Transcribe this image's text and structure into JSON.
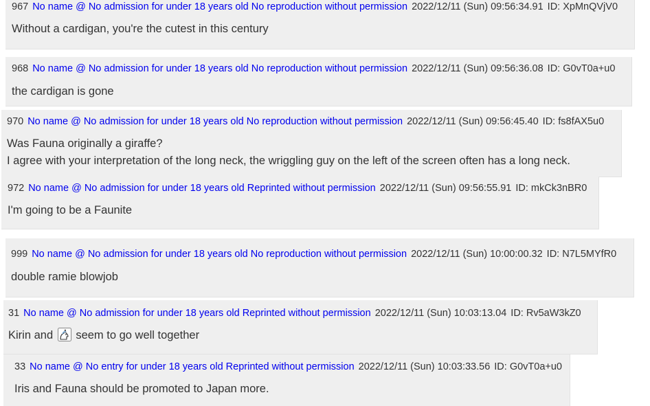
{
  "posts": [
    {
      "number": "967",
      "name": "No name @ No admission for under 18 years old No reproduction without permission",
      "date": "2022/12/11 (Sun) 09:56:34.91",
      "id": "ID: XpMnQVjV0",
      "lines": [
        "Without a cardigan, you're the cutest in this century"
      ]
    },
    {
      "number": "968",
      "name": "No name @ No admission for under 18 years old No reproduction without permission",
      "date": "2022/12/11 (Sun) 09:56:36.08",
      "id": "ID: G0vT0a+u0",
      "lines": [
        "the cardigan is gone"
      ]
    },
    {
      "number": "970",
      "name": "No name @ No admission for under 18 years old No reproduction without permission",
      "date": "2022/12/11 (Sun) 09:56:45.40",
      "id": "ID: fs8fAX5u0",
      "lines": [
        "Was Fauna originally a giraffe?",
        "I agree with your interpretation of the long neck, the wriggling guy on the left of the screen often has a long neck."
      ]
    },
    {
      "number": "972",
      "name": "No name @ No admission for under 18 years old Reprinted without permission",
      "date": "2022/12/11 (Sun) 09:56:55.91",
      "id": "ID: mkCk3nBR0",
      "lines": [
        "I'm going to be a Faunite"
      ]
    },
    {
      "number": "999",
      "name": "No name @ No admission for under 18 years old No reproduction without permission",
      "date": "2022/12/11 (Sun) 10:00:00.32",
      "id": "ID: N7L5MYfR0",
      "lines": [
        "double ramie blowjob"
      ]
    },
    {
      "number": "31",
      "name": "No name @ No admission for under 18 years old Reprinted without permission",
      "date": "2022/12/11 (Sun) 10:03:13.04",
      "id": "ID: Rv5aW3kZ0",
      "text_before_emoji": "Kirin and",
      "emoji": "unicorn-icon",
      "text_after_emoji": "seem to go well together"
    },
    {
      "number": "33",
      "name": "No name @ No entry for under 18 years old Reprinted without permission",
      "date": "2022/12/11 (Sun) 10:03:33.56",
      "id": "ID: G0vT0a+u0",
      "lines": [
        "Iris and Fauna should be promoted to Japan more."
      ]
    }
  ]
}
